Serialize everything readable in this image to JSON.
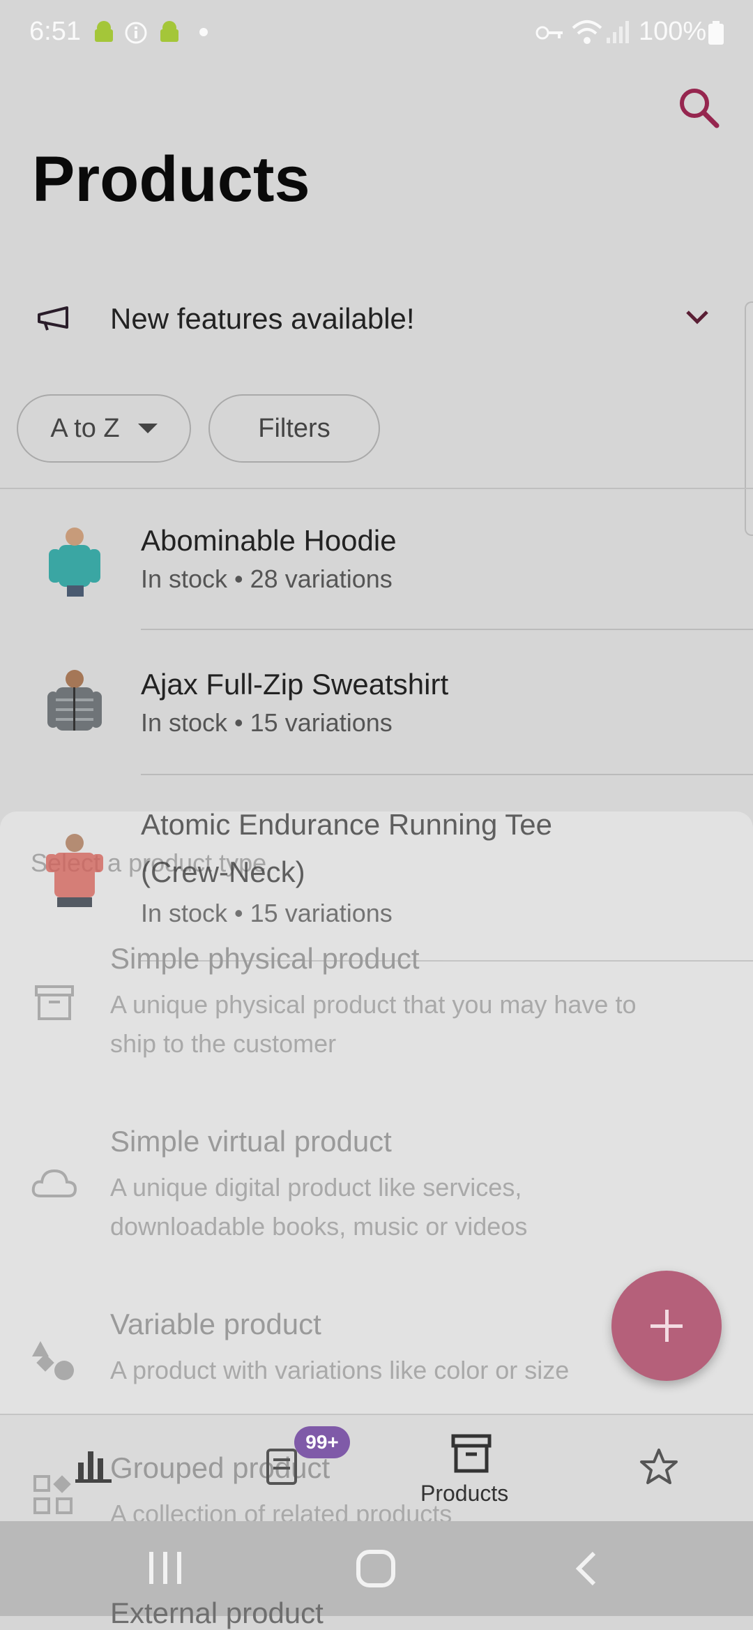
{
  "status_bar": {
    "time": "6:51",
    "battery": "100%"
  },
  "header": {
    "title": "Products"
  },
  "banner": {
    "text": "New features available!"
  },
  "chips": {
    "sort_label": "A to Z",
    "filters_label": "Filters"
  },
  "products": [
    {
      "name": "Abominable Hoodie",
      "subtitle": "In stock • 28 variations"
    },
    {
      "name": "Ajax Full-Zip Sweatshirt",
      "subtitle": "In stock • 15 variations"
    },
    {
      "name_line1": "Atomic Endurance Running Tee",
      "name_line2": "(Crew-Neck)",
      "subtitle": "In stock • 15 variations"
    }
  ],
  "sheet": {
    "title": "Select a product type",
    "options": [
      {
        "title": "Simple physical product",
        "desc_line1": "A unique physical product that you may have to",
        "desc_line2": "ship to the customer",
        "icon": "archive-box-icon"
      },
      {
        "title": "Simple virtual product",
        "desc_line1": "A unique digital product like services,",
        "desc_line2": "downloadable books, music or videos",
        "icon": "cloud-icon"
      },
      {
        "title": "Variable product",
        "desc_line1": "A product with variations like color or size",
        "icon": "shapes-icon"
      },
      {
        "title": "Grouped product",
        "desc_line1": "A collection of related products",
        "icon": "grid-icon"
      },
      {
        "title": "External product"
      }
    ]
  },
  "bottom_nav": {
    "orders_badge": "99+",
    "products_label": "Products"
  },
  "colors": {
    "accent": "#96264f",
    "fab": "#b5607a",
    "badge": "#7f5aa8"
  }
}
